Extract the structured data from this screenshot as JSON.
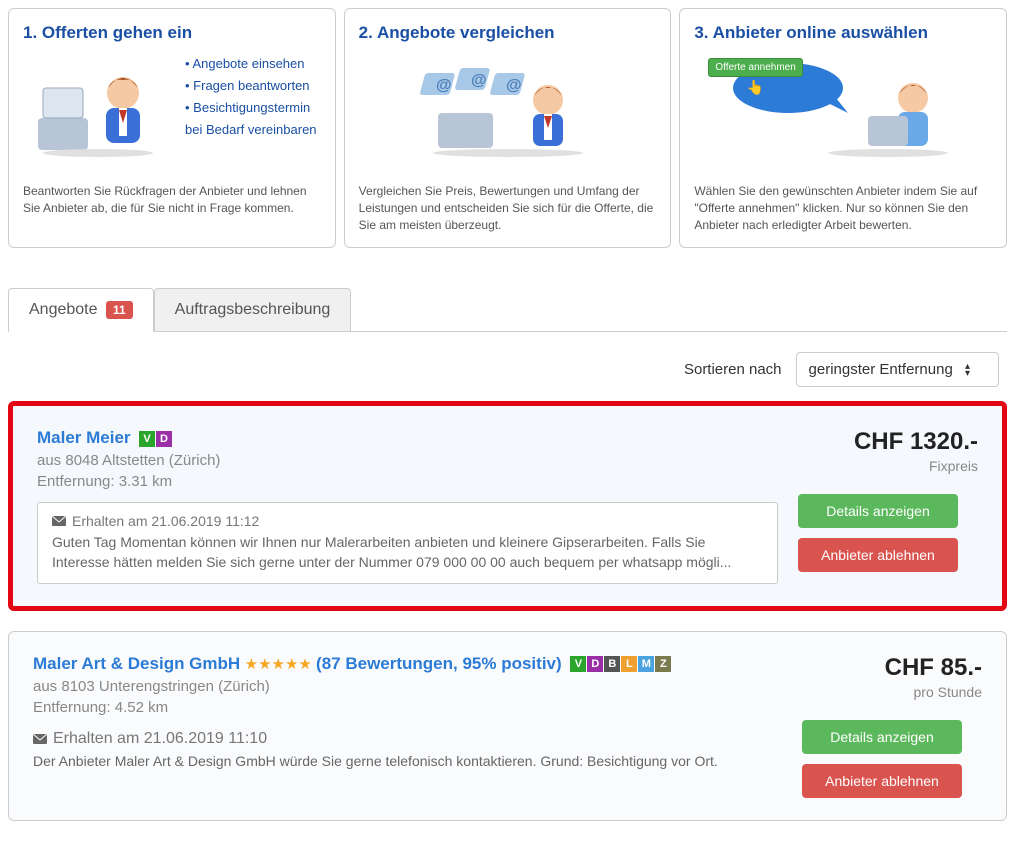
{
  "steps": [
    {
      "title": "1. Offerten gehen ein",
      "bullets": [
        "Angebote einsehen",
        "Fragen beantworten",
        "Besichtigungstermin bei Bedarf vereinbaren"
      ],
      "desc": "Beantworten Sie Rückfragen der Anbieter und lehnen Sie Anbieter ab, die für Sie nicht in Frage kommen."
    },
    {
      "title": "2. Angebote vergleichen",
      "desc": "Vergleichen Sie Preis, Bewertungen und Umfang der Leistungen und entscheiden Sie sich für die Offerte, die Sie am meisten überzeugt."
    },
    {
      "title": "3. Anbieter online auswählen",
      "bubble_label": "Offerte annehmen",
      "desc": "Wählen Sie den gewünschten Anbieter indem Sie auf \"Offerte annehmen\" klicken. Nur so können Sie den Anbieter nach erledigter Arbeit bewerten."
    }
  ],
  "tabs": {
    "offers": "Angebote",
    "offers_count": "11",
    "desc": "Auftragsbeschreibung"
  },
  "sort": {
    "label": "Sortieren nach",
    "selected": "geringster Entfernung"
  },
  "offers": [
    {
      "name": "Maler Meier",
      "badges": [
        "V",
        "D"
      ],
      "stars": 0,
      "rating_text": "",
      "location": "aus 8048 Altstetten (Zürich)",
      "distance": "Entfernung: 3.31 km",
      "price": "CHF 1320.-",
      "price_sub": "Fixpreis",
      "received": "Erhalten am 21.06.2019 11:12",
      "message": "Guten Tag Momentan können wir Ihnen nur Malerarbeiten anbieten und kleinere Gipserarbeiten. Falls Sie Interesse hätten melden Sie sich gerne unter der Nummer 079 000 00 00 auch bequem per whatsapp mögli...",
      "btn_details": "Details anzeigen",
      "btn_reject": "Anbieter ablehnen",
      "highlighted": true,
      "msg_boxed": true
    },
    {
      "name": "Maler Art & Design GmbH",
      "badges": [
        "V",
        "D",
        "B",
        "L",
        "M",
        "Z"
      ],
      "stars": 5,
      "rating_text": "(87 Bewertungen, 95% positiv)",
      "location": "aus 8103 Unterengstringen (Zürich)",
      "distance": "Entfernung: 4.52 km",
      "price": "CHF 85.-",
      "price_sub": "pro Stunde",
      "received": "Erhalten am 21.06.2019 11:10",
      "message": "Der Anbieter Maler Art & Design GmbH würde Sie gerne telefonisch kontaktieren. Grund: Besichtigung vor Ort.",
      "btn_details": "Details anzeigen",
      "btn_reject": "Anbieter ablehnen",
      "highlighted": false,
      "msg_boxed": false
    }
  ]
}
